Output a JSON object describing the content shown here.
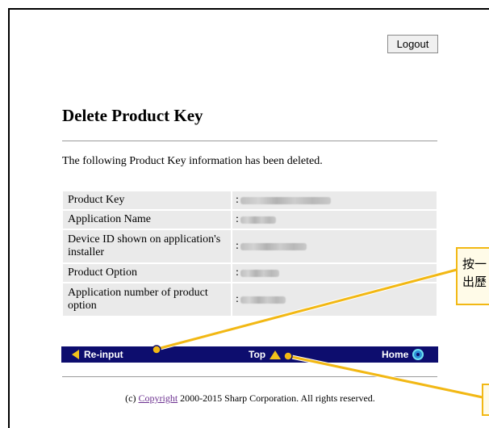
{
  "header": {
    "logout_label": "Logout"
  },
  "page": {
    "title": "Delete Product Key",
    "message": "The following Product Key information has been deleted."
  },
  "info_rows": [
    {
      "label": "Product Key",
      "value": ""
    },
    {
      "label": "Application Name",
      "value": ""
    },
    {
      "label": "Device ID shown on application's installer",
      "value": ""
    },
    {
      "label": "Product Option",
      "value": ""
    },
    {
      "label": "Application number of product option",
      "value": ""
    }
  ],
  "nav": {
    "reinput_label": "Re-input",
    "top_label": "Top",
    "home_label": "Home"
  },
  "footer": {
    "prefix": "(c) ",
    "link": "Copyright",
    "suffix": " 2000-2015 Sharp Corporation. All rights reserved."
  },
  "annotations": {
    "callout1": "按一\n出歷",
    "callout2": ""
  },
  "colors": {
    "nav_background": "#0d0d6e",
    "nav_icon": "#f2c21b",
    "callout_border": "#f2b814",
    "link": "#6b2f8f"
  },
  "icons": [
    "arrow-left-icon",
    "arrow-up-icon",
    "home-icon"
  ]
}
